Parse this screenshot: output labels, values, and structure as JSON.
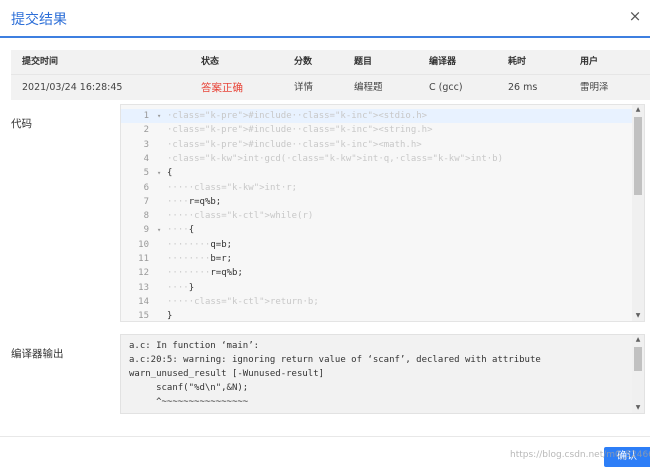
{
  "dialog": {
    "title": "提交结果",
    "close_glyph": "×",
    "confirm_label": "确认"
  },
  "table": {
    "headers": [
      "提交时间",
      "状态",
      "分数",
      "题目",
      "编译器",
      "耗时",
      "用户"
    ],
    "row": {
      "submit_time": "2021/03/24 16:28:45",
      "status": "答案正确",
      "score": "详情",
      "problem": "编程题",
      "compiler": "C (gcc)",
      "time_cost": "26 ms",
      "user": "雷明泽"
    }
  },
  "code_section": {
    "label": "代码",
    "lines": [
      "#include <stdio.h>",
      "#include <string.h>",
      "#include <math.h>",
      "int gcd(int q,int b)",
      "{",
      "    int r;",
      "    r=q%b;",
      "    while(r)",
      "    {",
      "        q=b;",
      "        b=r;",
      "        r=q%b;",
      "    }",
      "    return b;",
      "}"
    ],
    "line_numbers": [
      "1",
      "2",
      "3",
      "4",
      "5",
      "6",
      "7",
      "8",
      "9",
      "10",
      "11",
      "12",
      "13",
      "14",
      "15"
    ]
  },
  "compiler_output": {
    "label": "编译器输出",
    "lines": [
      "a.c: In function ‘main’:",
      "a.c:20:5: warning: ignoring return value of ‘scanf’, declared with attribute",
      "warn_unused_result [-Wunused-result]",
      "     scanf(\"%d\\n\",&N);",
      "     ^~~~~~~~~~~~~~~~~"
    ]
  },
  "watermark": "https://blog.csdn.net/m0_52466554",
  "icons": {
    "close": "close-icon",
    "fold": "fold-arrow-icon",
    "scroll_up": "scroll-up-icon",
    "scroll_down": "scroll-down-icon"
  },
  "colors": {
    "accent": "#2d6fd8",
    "status_accepted": "#e8463a",
    "confirm_button": "#2d7ef7"
  }
}
